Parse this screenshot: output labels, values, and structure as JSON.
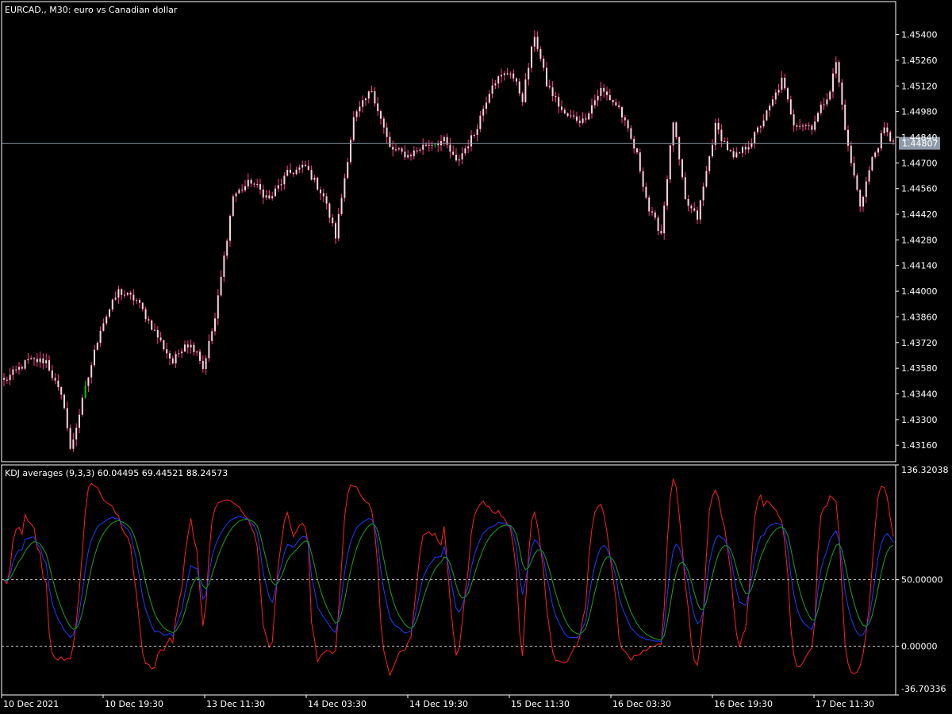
{
  "symbol_title": "EURCAD., M30:  euro vs Canadian dollar",
  "indicator_title": "KDJ averages (9,3,3) 60.04495 69.44521 88.24573",
  "current_price_label": "1.44807",
  "colors": {
    "background": "#000000",
    "frame": "#ffffff",
    "bull_candle": "#00c800",
    "bear_candle": "#ff3c8c",
    "candle_body": "#ffd2dc",
    "k_line": "#1e3cff",
    "d_line": "#1ea01e",
    "j_line": "#ff2020",
    "level_line": "#c0c0c0"
  },
  "chart_data": [
    {
      "type": "candlestick",
      "title": "EURCAD., M30:  euro vs Canadian dollar",
      "ylim": [
        1.4307,
        1.4558
      ],
      "y_ticks": [
        "1.45400",
        "1.45260",
        "1.45120",
        "1.44980",
        "1.44840",
        "1.44700",
        "1.44560",
        "1.44420",
        "1.44280",
        "1.44140",
        "1.44000",
        "1.43860",
        "1.43720",
        "1.43580",
        "1.43440",
        "1.43300",
        "1.43160"
      ],
      "current_price": 1.44807,
      "close_anchors": [
        [
          0,
          1.4351
        ],
        [
          8,
          1.4362
        ],
        [
          14,
          1.4362
        ],
        [
          20,
          1.4338
        ],
        [
          22,
          1.4313
        ],
        [
          26,
          1.434
        ],
        [
          32,
          1.438
        ],
        [
          38,
          1.44
        ],
        [
          44,
          1.4395
        ],
        [
          50,
          1.4378
        ],
        [
          56,
          1.4361
        ],
        [
          60,
          1.4372
        ],
        [
          64,
          1.4368
        ],
        [
          66,
          1.4358
        ],
        [
          70,
          1.4385
        ],
        [
          76,
          1.4452
        ],
        [
          82,
          1.446
        ],
        [
          88,
          1.445
        ],
        [
          94,
          1.4464
        ],
        [
          100,
          1.4468
        ],
        [
          106,
          1.4452
        ],
        [
          110,
          1.443
        ],
        [
          116,
          1.4494
        ],
        [
          122,
          1.451
        ],
        [
          128,
          1.4478
        ],
        [
          134,
          1.4474
        ],
        [
          140,
          1.448
        ],
        [
          146,
          1.4482
        ],
        [
          150,
          1.447
        ],
        [
          156,
          1.4486
        ],
        [
          162,
          1.4514
        ],
        [
          168,
          1.452
        ],
        [
          172,
          1.4505
        ],
        [
          176,
          1.454
        ],
        [
          180,
          1.4513
        ],
        [
          186,
          1.4496
        ],
        [
          192,
          1.4493
        ],
        [
          198,
          1.451
        ],
        [
          204,
          1.45
        ],
        [
          210,
          1.4474
        ],
        [
          214,
          1.4444
        ],
        [
          218,
          1.4432
        ],
        [
          222,
          1.4493
        ],
        [
          226,
          1.4449
        ],
        [
          230,
          1.444
        ],
        [
          236,
          1.449
        ],
        [
          242,
          1.4472
        ],
        [
          248,
          1.4482
        ],
        [
          254,
          1.45
        ],
        [
          258,
          1.4515
        ],
        [
          262,
          1.4492
        ],
        [
          268,
          1.449
        ],
        [
          274,
          1.451
        ],
        [
          276,
          1.4525
        ],
        [
          280,
          1.4478
        ],
        [
          284,
          1.4447
        ],
        [
          288,
          1.4472
        ],
        [
          292,
          1.4488
        ],
        [
          294,
          1.4483
        ]
      ],
      "bull_candle_indices": [
        27,
        143
      ]
    },
    {
      "type": "line",
      "title": "KDJ averages (9,3,3) 60.04495 69.44521 88.24573",
      "ylim": [
        -36.70336,
        136.32038
      ],
      "y_ticks": [
        "136.32038",
        "50.00000",
        "0.00000",
        "-36.70336"
      ],
      "levels": [
        50,
        0
      ],
      "series": [
        {
          "name": "K",
          "last_value": 60.04495
        },
        {
          "name": "D",
          "last_value": 69.44521
        },
        {
          "name": "J",
          "last_value": 88.24573
        }
      ],
      "x_tick_labels": [
        "10 Dec 2021",
        "10 Dec 19:30",
        "13 Dec 11:30",
        "14 Dec 03:30",
        "14 Dec 19:30",
        "15 Dec 11:30",
        "16 Dec 03:30",
        "16 Dec 19:30",
        "17 Dec 11:30"
      ]
    }
  ]
}
